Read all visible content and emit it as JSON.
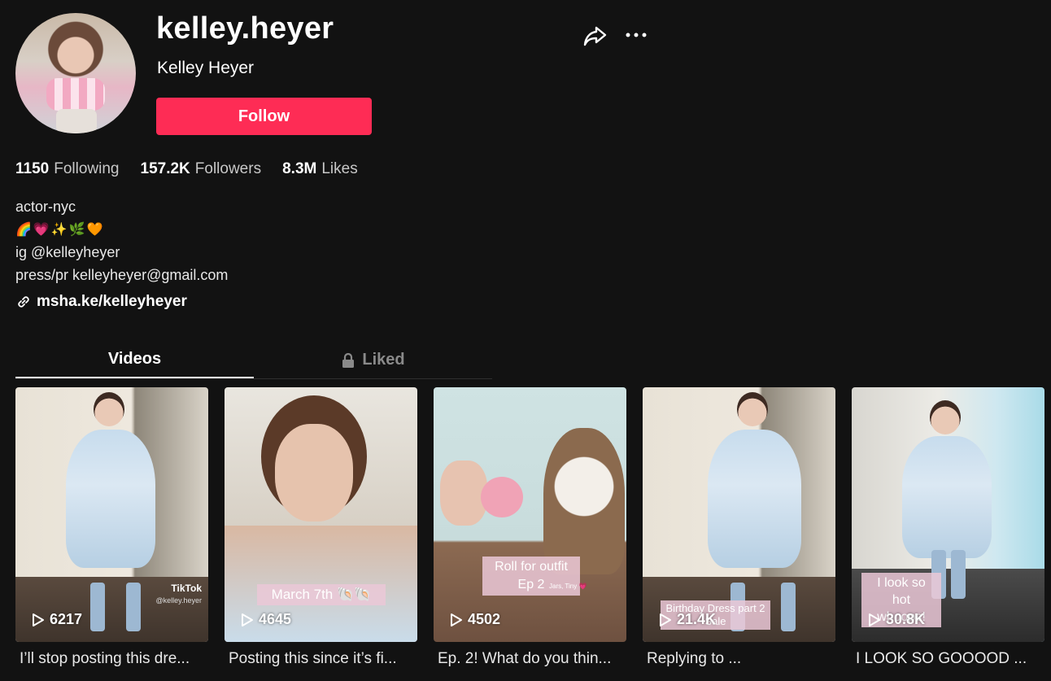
{
  "profile": {
    "handle": "kelley.heyer",
    "name": "Kelley Heyer",
    "follow_label": "Follow"
  },
  "stats": [
    {
      "value": "1150",
      "label": "Following"
    },
    {
      "value": "157.2K",
      "label": "Followers"
    },
    {
      "value": "8.3M",
      "label": "Likes"
    }
  ],
  "bio": {
    "line1": "actor-nyc",
    "emojis": [
      "🌈",
      "💗",
      "✨",
      "🌿",
      "🧡"
    ],
    "line3": "ig @kelleyheyer",
    "line4": "press/pr kelleyheyer@gmail.com"
  },
  "link": {
    "text": "msha.ke/kelleyheyer"
  },
  "tabs": [
    {
      "label": "Videos",
      "active": true
    },
    {
      "label": "Liked",
      "active": false
    }
  ],
  "videos": [
    {
      "views": "6217",
      "caption": "I’ll stop posting this dre...",
      "watermark_brand": "TikTok",
      "watermark_user": "@kelley.heyer"
    },
    {
      "views": "4645",
      "caption": "Posting this since it’s fi...",
      "overlay": "March 7th 🐚🐚"
    },
    {
      "views": "4502",
      "caption": "Ep. 2! What do you thin...",
      "overlay": "Roll for outfit Ep 2",
      "small_text": "Jars, Tiny 💗"
    },
    {
      "views": "21.4K",
      "caption": "Replying to ...",
      "overlay": "Birthday Dress part 2 Sale"
    },
    {
      "views": "30.8K",
      "caption": "I LOOK SO GOOOOD ...",
      "overlay": "I look so hot whoops!"
    }
  ],
  "colors": {
    "accent": "#fe2c55",
    "background": "#121212"
  }
}
